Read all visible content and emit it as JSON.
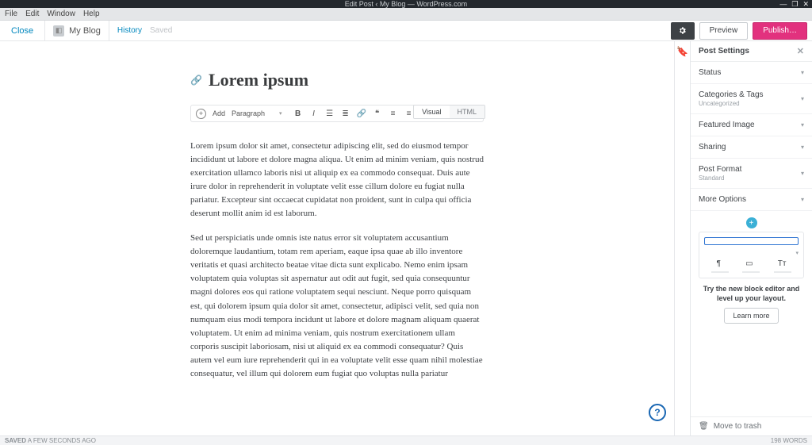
{
  "window": {
    "title": "Edit Post ‹ My Blog — WordPress.com",
    "menus": [
      "File",
      "Edit",
      "Window",
      "Help"
    ]
  },
  "toolbar": {
    "close": "Close",
    "site": "My Blog",
    "history": "History",
    "saved": "Saved",
    "preview": "Preview",
    "publish": "Publish…"
  },
  "editor": {
    "title": "Lorem ipsum",
    "tabs": {
      "visual": "Visual",
      "html": "HTML"
    },
    "add_label": "Add",
    "block_type": "Paragraph",
    "paragraphs": [
      "Lorem ipsum dolor sit amet, consectetur adipiscing elit, sed do eiusmod tempor incididunt ut labore et dolore magna aliqua. Ut enim ad minim veniam, quis nostrud exercitation ullamco laboris nisi ut aliquip ex ea commodo consequat. Duis aute irure dolor in reprehenderit in voluptate velit esse cillum dolore eu fugiat nulla pariatur. Excepteur sint occaecat cupidatat non proident, sunt in culpa qui officia deserunt mollit anim id est laborum.",
      "Sed ut perspiciatis unde omnis iste natus error sit voluptatem accusantium doloremque laudantium, totam rem aperiam, eaque ipsa quae ab illo inventore veritatis et quasi architecto beatae vitae dicta sunt explicabo. Nemo enim ipsam voluptatem quia voluptas sit aspernatur aut odit aut fugit, sed quia consequuntur magni dolores eos qui ratione voluptatem sequi nesciunt. Neque porro quisquam est, qui dolorem ipsum quia dolor sit amet, consectetur, adipisci velit, sed quia non numquam eius modi tempora incidunt ut labore et dolore magnam aliquam quaerat voluptatem. Ut enim ad minima veniam, quis nostrum exercitationem ullam corporis suscipit laboriosam, nisi ut aliquid ex ea commodi consequatur? Quis autem vel eum iure reprehenderit qui in ea voluptate velit esse quam nihil molestiae consequatur, vel illum qui dolorem eum fugiat quo voluptas nulla pariatur"
    ]
  },
  "sidebar": {
    "title": "Post Settings",
    "items": [
      {
        "label": "Status",
        "sub": ""
      },
      {
        "label": "Categories & Tags",
        "sub": "Uncategorized"
      },
      {
        "label": "Featured Image",
        "sub": ""
      },
      {
        "label": "Sharing",
        "sub": ""
      },
      {
        "label": "Post Format",
        "sub": "Standard"
      },
      {
        "label": "More Options",
        "sub": ""
      }
    ],
    "promo_text": "Try the new block editor and level up your layout.",
    "learn_more": "Learn more",
    "trash": "Move to trash"
  },
  "status": {
    "left_bold": "SAVED",
    "left_rest": " A FEW SECONDS AGO",
    "right": "198 WORDS"
  }
}
